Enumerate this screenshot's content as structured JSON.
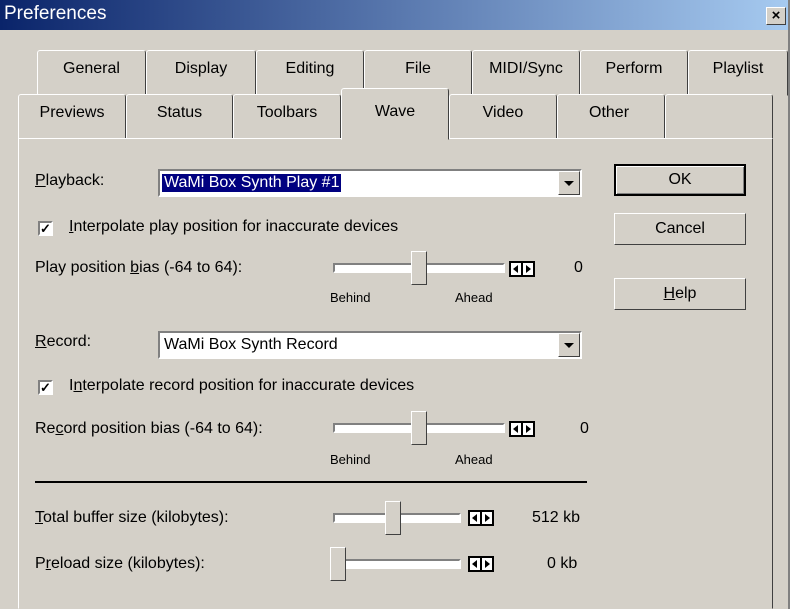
{
  "window": {
    "title": "Preferences",
    "close_label": "×"
  },
  "tabs_row_back": [
    "General",
    "Display",
    "Editing",
    "File",
    "MIDI/Sync",
    "Perform",
    "Playlist"
  ],
  "tabs_row_front": [
    "Previews",
    "Status",
    "Toolbars",
    "Wave",
    "Video",
    "Other"
  ],
  "active_tab": "Wave",
  "playback": {
    "label_u": "P",
    "label_rest": "layback:",
    "value": "WaMi Box Synth Play #1",
    "interpolate_checked": true,
    "interpolate_u": "I",
    "interpolate_rest": "nterpolate play position for inaccurate devices",
    "bias_pre": "Play position ",
    "bias_u": "b",
    "bias_post": "ias (-64 to 64):",
    "bias_value": "0",
    "bias_level": 0,
    "behind": "Behind",
    "ahead": "Ahead"
  },
  "record": {
    "label_u": "R",
    "label_rest": "ecord:",
    "value": "WaMi Box Synth Record",
    "interpolate_checked": true,
    "interpolate_pre": "I",
    "interpolate_u": "n",
    "interpolate_rest": "terpolate record position for inaccurate devices",
    "bias_pre": "Re",
    "bias_u": "c",
    "bias_post": "ord position bias (-64 to 64):",
    "bias_value": "0",
    "bias_level": 0,
    "behind": "Behind",
    "ahead": "Ahead"
  },
  "buffer": {
    "label_u": "T",
    "label_rest": "otal buffer size (kilobytes):",
    "value": "512 kb",
    "level_fraction": 0.47
  },
  "preload": {
    "label_pre": "P",
    "label_u": "r",
    "label_rest": "eload size (kilobytes):",
    "value": "0 kb",
    "level_fraction": 0.0
  },
  "buttons": {
    "ok": "OK",
    "cancel": "Cancel",
    "help_u": "H",
    "help_rest": "elp"
  },
  "colors": {
    "titlebar": "#0a246a",
    "selection": "#000080",
    "face": "#d4d0c8"
  }
}
